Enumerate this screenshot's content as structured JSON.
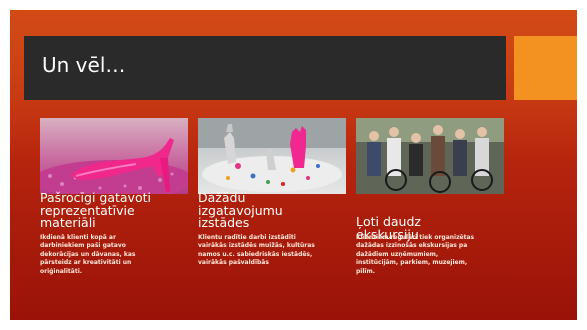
{
  "slide": {
    "title": "Un vēl…",
    "colors": {
      "background": "#c02f10",
      "title_bar": "#2a2a2a",
      "accent": "#f39220"
    }
  },
  "columns": [
    {
      "heading_lines": [
        "Pašrocīgi gatavoti",
        "reprezentatīvie",
        "materiāli"
      ],
      "description_lines": [
        "Ikdienā klienti kopā ar",
        "darbiniekiem paši gatavo",
        "dekorācijas un dāvanas, kas",
        "pārsteidz ar kreativitāti un",
        "oriģinalitāti."
      ]
    },
    {
      "heading_lines": [
        "Dažādu",
        "izgatavojumu",
        "izstādes"
      ],
      "description_lines": [
        "Klientu radītie darbi izstādīti",
        "vairākās izstādēs muižās, kultūras",
        "namos u.c. sabiedriskās iestādēs,",
        "vairākās pašvaldībās"
      ]
    },
    {
      "heading_lines": [
        "Ļoti daudz",
        "ekskursiju"
      ],
      "description_lines": [
        "Klientiem regulāri tiek organizētas",
        "dažādas izzinošās ekskursijas pa",
        "dažādiem uzņēmumiem,",
        "institūcijām, parkiem, muzejiem,",
        "pilīm."
      ]
    }
  ]
}
